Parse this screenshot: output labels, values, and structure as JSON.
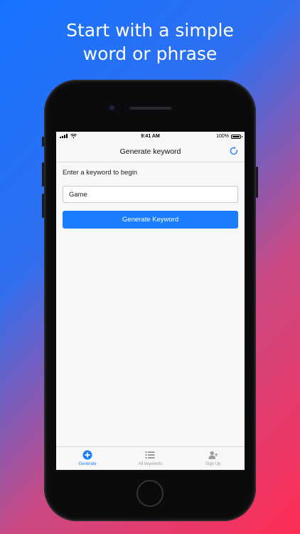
{
  "headline": {
    "line1": "Start with a simple",
    "line2": "word or phrase"
  },
  "status_bar": {
    "time": "9:41 AM",
    "battery": "100%"
  },
  "nav": {
    "title": "Generate keyword",
    "refresh_icon": "refresh-icon"
  },
  "form": {
    "prompt": "Enter a keyword to begin",
    "input_value": "Game",
    "button_label": "Generate Keyword"
  },
  "tabs": [
    {
      "label": "Generate",
      "icon": "plus-circle-icon",
      "active": true
    },
    {
      "label": "All keywords",
      "icon": "list-icon",
      "active": false
    },
    {
      "label": "Sign Up",
      "icon": "add-user-icon",
      "active": false
    }
  ],
  "colors": {
    "accent": "#1a7dfb",
    "inactive": "#9a9aa0"
  }
}
